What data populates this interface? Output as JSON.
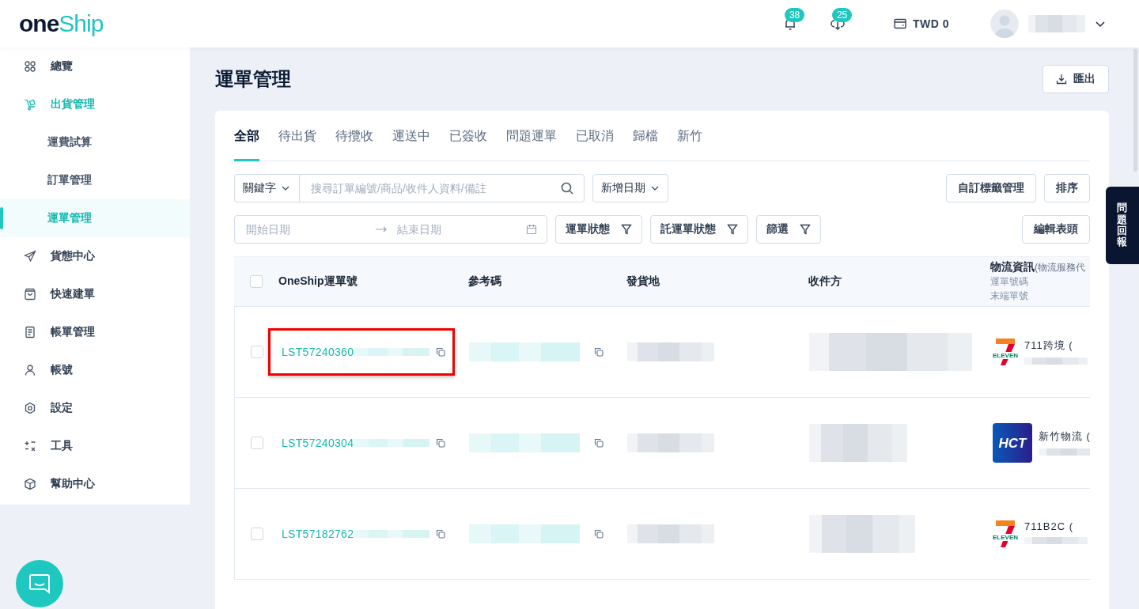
{
  "logo": {
    "part1": "one",
    "part2": "Ship"
  },
  "header": {
    "notifications": "38",
    "downloads": "25",
    "balance": "TWD 0"
  },
  "sidebar": [
    {
      "label": "總覽",
      "expanded": false
    },
    {
      "label": "出貨管理",
      "expanded": true,
      "children": [
        {
          "label": "運費試算",
          "selected": false
        },
        {
          "label": "訂單管理",
          "selected": false
        },
        {
          "label": "運單管理",
          "selected": true
        }
      ]
    },
    {
      "label": "貨態中心",
      "expanded": false
    },
    {
      "label": "快速建單",
      "expanded": false
    },
    {
      "label": "帳單管理",
      "expanded": false
    },
    {
      "label": "帳號",
      "expanded": false
    },
    {
      "label": "設定",
      "expanded": false
    },
    {
      "label": "工具",
      "expanded": false
    },
    {
      "label": "幫助中心",
      "expanded": false
    }
  ],
  "page_title": "運單管理",
  "export_button": "匯出",
  "tabs": [
    {
      "label": "全部",
      "selected": true
    },
    {
      "label": "待出貨",
      "selected": false
    },
    {
      "label": "待攬收",
      "selected": false
    },
    {
      "label": "運送中",
      "selected": false
    },
    {
      "label": "已簽收",
      "selected": false
    },
    {
      "label": "問題運單",
      "selected": false
    },
    {
      "label": "已取消",
      "selected": false
    },
    {
      "label": "歸檔",
      "selected": false
    },
    {
      "label": "新竹",
      "selected": false
    }
  ],
  "filters": {
    "keyword_select": "關鍵字",
    "search": {
      "placeholder": "搜尋訂單編號/商品/收件人資料/備註"
    },
    "date_select": "新增日期",
    "start_date": {
      "placeholder": "開始日期"
    },
    "end_date": {
      "placeholder": "結束日期"
    },
    "filter_buttons": [
      "運單狀態",
      "託運單狀態",
      "篩選"
    ],
    "right_buttons": [
      "自訂標籤管理",
      "排序"
    ],
    "edit_columns": "編輯表頭"
  },
  "table": {
    "header_checked": false,
    "columns": [
      "OneShip運單號",
      "參考碼",
      "發貨地",
      "收件方"
    ],
    "logistics_column": {
      "title": "物流資訊",
      "note": "(物流服務代",
      "sub": [
        "運單號碼",
        "末端單號"
      ]
    },
    "rows": [
      {
        "tracking": "LST57240360",
        "checked": false,
        "highlighted": true,
        "carrier": {
          "kind": "seven",
          "logo_text": "ELEVEN",
          "name": "711跨境 ("
        }
      },
      {
        "tracking": "LST57240304",
        "checked": false,
        "highlighted": false,
        "carrier": {
          "kind": "hct",
          "logo_text": "HCT",
          "name": "新竹物流 ("
        }
      },
      {
        "tracking": "LST57182762",
        "checked": false,
        "highlighted": false,
        "carrier": {
          "kind": "seven",
          "logo_text": "ELEVEN",
          "name": "711B2C ("
        }
      }
    ]
  },
  "feedback_tab": "問題回報"
}
